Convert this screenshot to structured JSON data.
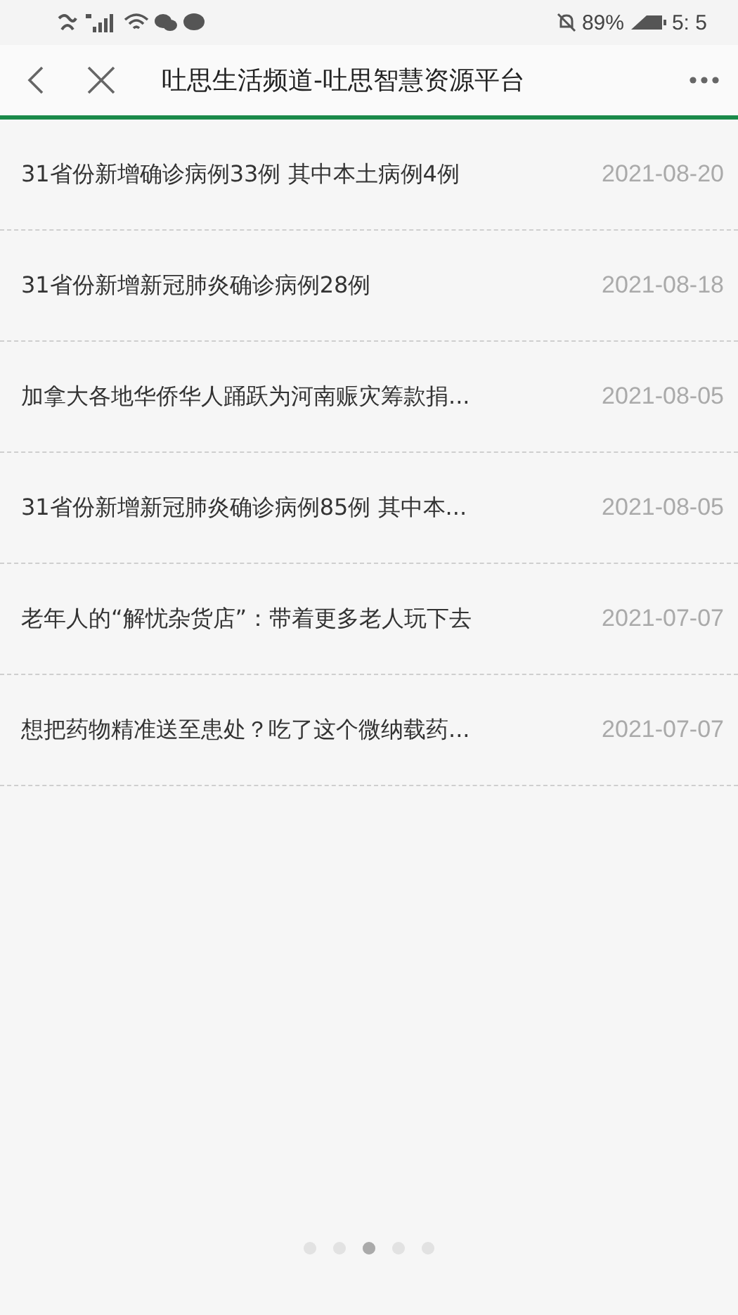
{
  "status_bar": {
    "battery": "89%",
    "time": "5: 5"
  },
  "header": {
    "title": "吐思生活频道-吐思智慧资源平台"
  },
  "articles": [
    {
      "title": "31省份新增确诊病例33例 其中本土病例4例",
      "date": "2021-08-20"
    },
    {
      "title": "31省份新增新冠肺炎确诊病例28例",
      "date": "2021-08-18"
    },
    {
      "title": "加拿大各地华侨华人踊跃为河南赈灾筹款捐...",
      "date": "2021-08-05"
    },
    {
      "title": "31省份新增新冠肺炎确诊病例85例 其中本...",
      "date": "2021-08-05"
    },
    {
      "title": "老年人的“解忧杂货店”：带着更多老人玩下去",
      "date": "2021-07-07"
    },
    {
      "title": "想把药物精准送至患处？吃了这个微纳载药...",
      "date": "2021-07-07"
    }
  ],
  "pager": [
    {
      "selected": false
    },
    {
      "selected": false
    },
    {
      "selected": true
    },
    {
      "selected": false
    },
    {
      "selected": false
    }
  ]
}
